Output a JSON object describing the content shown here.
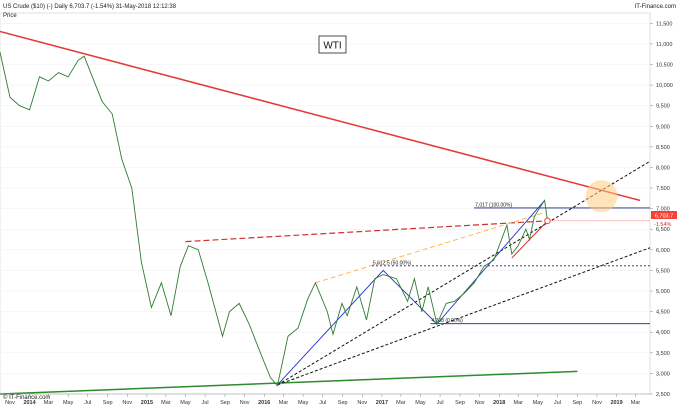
{
  "header": {
    "title": "US Crude ($10) (-)  Daily  6,703.7 (-1.54%)  31-May-2018 12:12:38",
    "brand": "IT-Finance.com",
    "price_label": "Price",
    "copyright": "© IT-Finance.com"
  },
  "chart_data": {
    "type": "line",
    "title": "WTI",
    "x_ticks": [
      "Nov",
      "2014",
      "Mar",
      "May",
      "Jul",
      "Sep",
      "Nov",
      "2015",
      "Mar",
      "May",
      "Jul",
      "Sep",
      "Nov",
      "2016",
      "Mar",
      "May",
      "Jul",
      "Sep",
      "Nov",
      "2017",
      "Mar",
      "May",
      "Jul",
      "Sep",
      "Nov",
      "2018",
      "Mar",
      "May",
      "Jul",
      "Sep",
      "Nov",
      "2019",
      "Mar"
    ],
    "y_ticks": [
      "11,500",
      "11,000",
      "10,500",
      "10,000",
      "9,500",
      "9,000",
      "8,500",
      "8,000",
      "7,500",
      "7,000",
      "6,500",
      "6,000",
      "5,500",
      "5,000",
      "4,500",
      "4,000",
      "3,500",
      "3,000",
      "2,500"
    ],
    "ylim": [
      2500,
      11750
    ],
    "last_price_label": "6,703.7",
    "last_change_label": "-1.54%",
    "series": [
      {
        "values": [
          [
            "2013-10-01",
            10800
          ],
          [
            "2013-11-01",
            9700
          ],
          [
            "2013-12-01",
            9500
          ],
          [
            "2014-01-01",
            9400
          ],
          [
            "2014-02-01",
            10200
          ],
          [
            "2014-03-01",
            10100
          ],
          [
            "2014-04-01",
            10300
          ],
          [
            "2014-05-01",
            10200
          ],
          [
            "2014-06-01",
            10600
          ],
          [
            "2014-06-20",
            10700
          ],
          [
            "2014-07-15",
            10200
          ],
          [
            "2014-08-15",
            9600
          ],
          [
            "2014-09-15",
            9300
          ],
          [
            "2014-10-15",
            8200
          ],
          [
            "2014-11-15",
            7500
          ],
          [
            "2014-12-15",
            5700
          ],
          [
            "2015-01-15",
            4600
          ],
          [
            "2015-02-15",
            5200
          ],
          [
            "2015-03-17",
            4400
          ],
          [
            "2015-04-15",
            5600
          ],
          [
            "2015-05-10",
            6100
          ],
          [
            "2015-06-10",
            6000
          ],
          [
            "2015-07-10",
            5200
          ],
          [
            "2015-08-24",
            3900
          ],
          [
            "2015-09-15",
            4500
          ],
          [
            "2015-10-15",
            4700
          ],
          [
            "2015-11-15",
            4200
          ],
          [
            "2015-12-20",
            3500
          ],
          [
            "2016-01-20",
            2900
          ],
          [
            "2016-02-11",
            2700
          ],
          [
            "2016-03-15",
            3900
          ],
          [
            "2016-04-15",
            4100
          ],
          [
            "2016-05-15",
            4800
          ],
          [
            "2016-06-08",
            5200
          ],
          [
            "2016-07-15",
            4500
          ],
          [
            "2016-08-02",
            3950
          ],
          [
            "2016-08-30",
            4700
          ],
          [
            "2016-09-15",
            4400
          ],
          [
            "2016-10-15",
            5100
          ],
          [
            "2016-11-14",
            4300
          ],
          [
            "2016-12-10",
            5300
          ],
          [
            "2017-01-05",
            5400
          ],
          [
            "2017-02-15",
            5300
          ],
          [
            "2017-03-22",
            4750
          ],
          [
            "2017-04-12",
            5300
          ],
          [
            "2017-05-05",
            4500
          ],
          [
            "2017-05-25",
            5100
          ],
          [
            "2017-06-21",
            4200
          ],
          [
            "2017-07-20",
            4700
          ],
          [
            "2017-08-15",
            4750
          ],
          [
            "2017-09-15",
            4950
          ],
          [
            "2017-10-15",
            5200
          ],
          [
            "2017-11-15",
            5600
          ],
          [
            "2017-12-15",
            5750
          ],
          [
            "2018-01-25",
            6600
          ],
          [
            "2018-02-09",
            5900
          ],
          [
            "2018-03-01",
            6100
          ],
          [
            "2018-03-25",
            6500
          ],
          [
            "2018-04-05",
            6250
          ],
          [
            "2018-04-20",
            6800
          ],
          [
            "2018-05-05",
            7000
          ],
          [
            "2018-05-22",
            7200
          ],
          [
            "2018-05-31",
            6703.7
          ]
        ]
      }
    ],
    "annotations": [
      {
        "text": "7,017 (100.00%)",
        "level": 7017
      },
      {
        "text": "5,612.5 (50.00%)",
        "level": 5612.5
      },
      {
        "text": "4,208 (0.00%)",
        "level": 4208
      }
    ],
    "colors": {
      "price": "#2e7d32",
      "down_trend": "#e53935",
      "resistance_dashed": "#d32f2f",
      "support": "#2e8b2e",
      "channel": "#111111",
      "fib": "#1a237e",
      "abc": "#2233cc",
      "orange_dashed": "#ffb74d",
      "highlight": "#ffcc80",
      "last_box": "#f44336"
    }
  }
}
